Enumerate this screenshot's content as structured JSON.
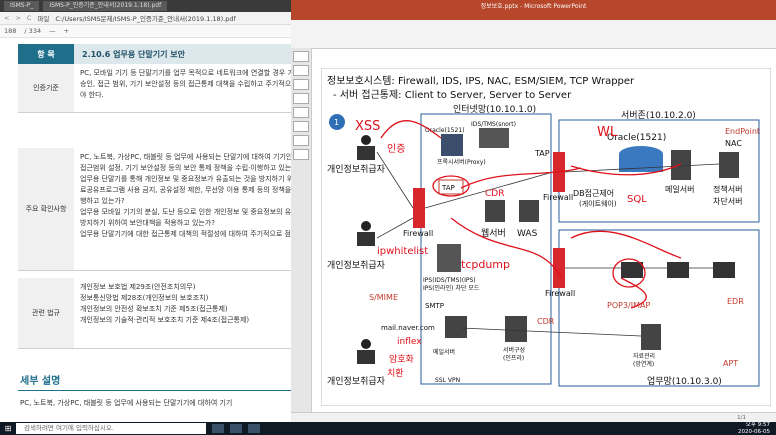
{
  "pdf": {
    "tab_title": "ISMS-P_",
    "tab_title2": "ISMS-P_인증기준_안내서(2019.1.18).pdf",
    "nav_back": "<",
    "nav_fwd": ">",
    "nav_reload": "C",
    "address_prefix": "파일",
    "address_path": "C:/Users/ISMS문제/ISMS-P_인증기준_안내서(2019.1.18).pdf",
    "page_num": "188",
    "page_total": "/ 334",
    "zoom_minus": "—",
    "zoom_plus": "+",
    "header_label": "항 목",
    "header_title": "2.10.6 업무용 단말기기 보안",
    "rows": {
      "criteria": {
        "label": "인증기준",
        "lines": [
          "PC, 모바일 기기 등 단말기기를 업무 목적으로 네트워크에 연결할 경우 기기 인증 및",
          "승인, 접근 범위, 기기 보안설정 등의 접근통제 대책을 수립하고 주기적으로 점검하여",
          "야 한다."
        ]
      },
      "check": {
        "label": "주요 확인사항",
        "lines": [
          "PC, 노트북, 가상PC, 태블릿 등 업무에 사용되는 단말기에 대하여 기기인증, 승인,",
          "접근범위 설정, 기기 보안설정 등의 보안 통제 정책을 수립·이행하고 있는가?",
          "업무용 단말기를 통해 개인정보 및 중요정보가 유출되는 것을 방지하기 위하여 자",
          "료공유프로그램 사용 금지, 공유설정 제한, 무선망 이용 통제 등의 정책을 수립·이",
          "행하고 있는가?",
          "업무용 모바일 기기의 분실, 도난 등으로 인한 개인정보 및 중요정보의 유·노출을",
          "방지하기 위하여 보안대책을 적용하고 있는가?",
          "업무용 단말기기에 대한 접근통제 대책의 적절성에 대하여 주기적으로 점검하고 있는가?"
        ]
      },
      "law": {
        "label": "관련 법규",
        "lines": [
          "개인정보 보호법 제29조(안전조치의무)",
          "정보통신망법 제28조(개인정보의 보호조치)",
          "개인정보의 안전성 확보조치 기준 제5조(접근통제)",
          "개인정보의 기술적·관리적 보호조치 기준 제4조(접근통제)"
        ]
      }
    },
    "section_title": "세부 설명",
    "section_body": "PC, 노트북, 가상PC, 태블릿 등 업무에 사용되는 단말기기에 대하여 기기"
  },
  "ppt": {
    "window_title": "정보보호.pptx - Microsoft PowerPoint",
    "status_page": "1/1",
    "slide": {
      "title_line1": "정보보호시스템: Firewall, IDS, IPS, NAC, ESM/SIEM, TCP Wrapper",
      "title_line2": "- 서버 접근통제: Client to Server, Server to Server",
      "badge": "1",
      "zone_internet": "인터넷망(10.10.1.0)",
      "zone_server": "서버존(10.10.2.0)",
      "zone_business": "업무망(10.10.3.0)",
      "user1": "개인정보취급자",
      "user2": "개인정보취급자",
      "user3": "개인정보취급자",
      "oracle_left": "Oracle(1521)",
      "ids_label": "IDS/TMS(snort)",
      "proxy_label": "프록시서버(Proxy)",
      "tap1": "TAP",
      "tap2": "TAP",
      "web_server": "웹서버",
      "was": "WAS",
      "firewall1": "Firewall",
      "firewall2": "Firewall",
      "firewall3": "Firewall",
      "ips_label": "IPS(IDS/TMS)(IPS)",
      "ips_sub": "IPS(인라인) 차단 모드",
      "smtp": "SMTP",
      "mail_addr": "mail.naver.com",
      "smime": "S/MIME",
      "mail_server": "메일서버",
      "sslvpn": "SSL VPN",
      "oracle_right": "Oracle(1521)",
      "db_gateway": "DB접근제어",
      "db_gateway_sub": "(게이트웨이)",
      "mail_server2": "메일서버",
      "nac": "NAC",
      "endpoint": "EndPoint",
      "nac_server1": "정책서버",
      "nac_server2": "차단서버",
      "pop3": "POP3/IMAP",
      "edr": "EDR",
      "cdr": "CDR",
      "apt": "APT",
      "infra1": "서버구성",
      "infra2": "(인프라)",
      "infra3": "자료관리",
      "infra4": "(망연계)",
      "hand_1": "XSS",
      "hand_2": "인증",
      "hand_3": "WL",
      "hand_4": "SQL",
      "hand_5": "ipwhitelist",
      "hand_6": "tcpdump",
      "hand_7": "inflex",
      "hand_8": "암호화",
      "hand_9": "치환",
      "hand_10": "CDR"
    }
  },
  "taskbar": {
    "search_placeholder": "검색하려면 여기에 입력하십시오.",
    "time": "오후 9:57",
    "date": "2020-06-05"
  },
  "colors": {
    "pdf_header": "#1f6f8b",
    "ppt_brand": "#b7472a",
    "firewall": "#d7262c",
    "ink": "#e0101a"
  }
}
